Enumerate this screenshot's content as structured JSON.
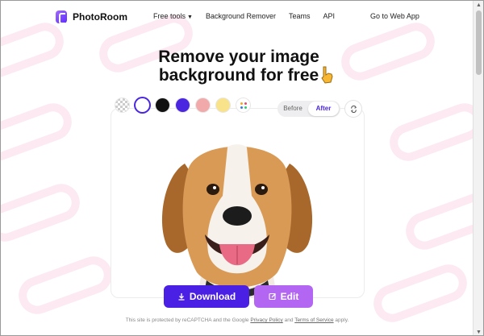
{
  "brand": {
    "name": "PhotoRoom"
  },
  "nav": {
    "items": [
      "Free tools",
      "Background Remover",
      "Teams",
      "API"
    ],
    "cta": "Go to Web App"
  },
  "hero": {
    "title_line1": "Remove your image",
    "title_line2": "background for free"
  },
  "swatches": [
    {
      "name": "transparent",
      "color": "transparent"
    },
    {
      "name": "white",
      "color": "#ffffff",
      "selected": true
    },
    {
      "name": "black",
      "color": "#111111"
    },
    {
      "name": "blue",
      "color": "#4b26e0"
    },
    {
      "name": "pink",
      "color": "#f2a9a9"
    },
    {
      "name": "yellow",
      "color": "#f9e38a"
    },
    {
      "name": "more-colors",
      "icon": "palette-icon"
    }
  ],
  "toggle": {
    "before": "Before",
    "after": "After",
    "active": "After"
  },
  "actions": {
    "download": "Download",
    "edit": "Edit"
  },
  "footer": {
    "prefix": "This site is protected by reCAPTCHA and the Google",
    "privacy": "Privacy Policy",
    "and": "and",
    "terms": "Terms of Service",
    "suffix": "apply."
  },
  "colors": {
    "accent": "#4b20e5",
    "edit": "#b266f2"
  }
}
